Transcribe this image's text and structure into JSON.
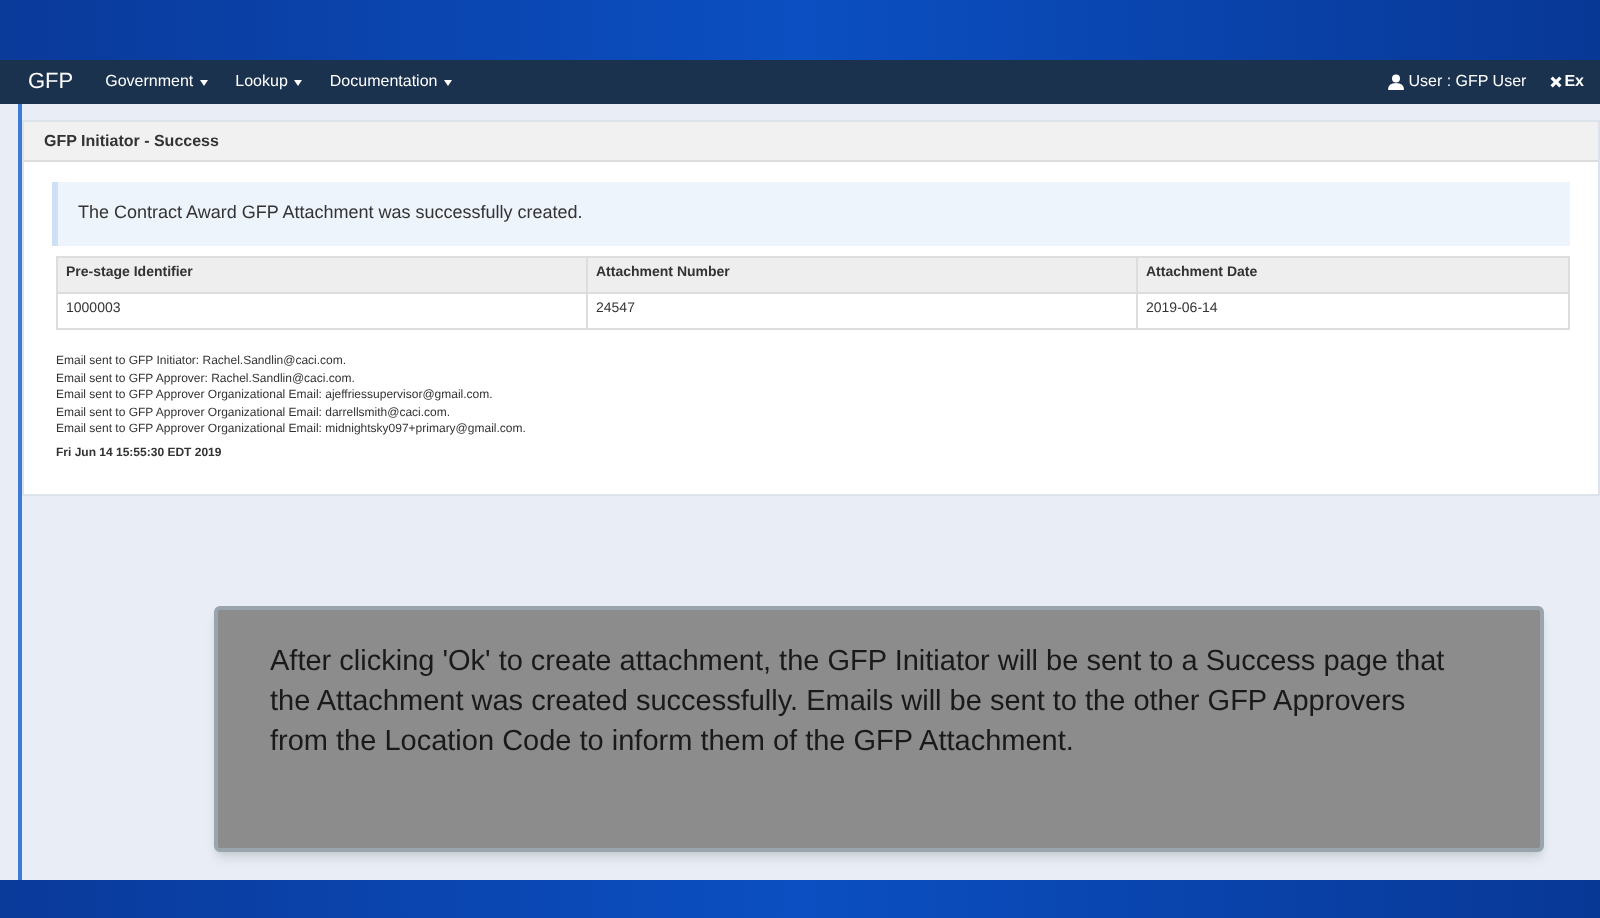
{
  "navbar": {
    "brand": "GFP",
    "menus": [
      {
        "label": "Government"
      },
      {
        "label": "Lookup"
      },
      {
        "label": "Documentation"
      }
    ],
    "user": "User : GFP User",
    "exit": "Ex"
  },
  "panel": {
    "title": "GFP Initiator - Success",
    "alert": "The Contract Award GFP Attachment was successfully created.",
    "table": {
      "columns": [
        "Pre-stage Identifier",
        "Attachment Number",
        "Attachment Date"
      ],
      "rows": [
        [
          "1000003",
          "24547",
          "2019-06-14"
        ]
      ]
    },
    "emails": [
      "Email sent to GFP Initiator: Rachel.Sandlin@caci.com.",
      "Email sent to GFP Approver: Rachel.Sandlin@caci.com.",
      "Email sent to GFP Approver Organizational Email: ajeffriessupervisor@gmail.com.",
      "Email sent to GFP Approver Organizational Email: darrellsmith@caci.com.",
      "Email sent to GFP Approver Organizational Email: midnightsky097+primary@gmail.com."
    ],
    "timestamp": "Fri Jun 14 15:55:30 EDT 2019"
  },
  "caption": "After clicking 'Ok' to create attachment, the GFP Initiator will be sent to a Success page that the Attachment was created successfully. Emails will be sent to the other GFP Approvers from the Location Code to inform them of the GFP Attachment."
}
